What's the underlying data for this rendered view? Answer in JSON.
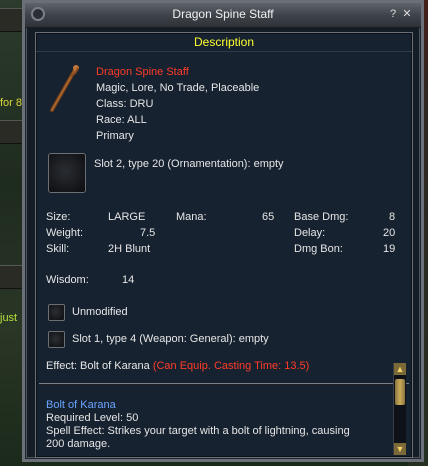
{
  "background": {
    "left_text_1": "for 8",
    "left_text_2": "just"
  },
  "window": {
    "title": "Dragon Spine Staff",
    "help_label": "?",
    "close_label": "✕"
  },
  "description": {
    "header": "Description",
    "item_name": "Dragon Spine Staff",
    "flags": "Magic, Lore, No Trade, Placeable",
    "class": "Class: DRU",
    "race": "Race: ALL",
    "slot_type": "Primary",
    "ornament_slot": "Slot 2, type 20 (Ornamentation): empty"
  },
  "stats": {
    "size_label": "Size:",
    "size_value": "LARGE",
    "weight_label": "Weight:",
    "weight_value": "7.5",
    "skill_label": "Skill:",
    "skill_value": "2H Blunt",
    "mana_label": "Mana:",
    "mana_value": "65",
    "base_dmg_label": "Base Dmg:",
    "base_dmg_value": "8",
    "delay_label": "Delay:",
    "delay_value": "20",
    "dmg_bon_label": "Dmg Bon:",
    "dmg_bon_value": "19",
    "wisdom_label": "Wisdom:",
    "wisdom_value": "14"
  },
  "augments": {
    "unmodified_label": "Unmodified",
    "weapon_slot": "Slot 1, type 4 (Weapon: General): empty"
  },
  "effect": {
    "label": "Effect: Bolt of Karana",
    "detail": "(Can Equip. Casting Time: 13.5)"
  },
  "spell": {
    "name": "Bolt of Karana",
    "required_level": "Required Level: 50",
    "effect_line1": "Spell Effect: Strikes your target with a bolt of lightning, causing",
    "effect_line2": "200 damage."
  },
  "colors": {
    "header_yellow": "#ffff30",
    "item_name_red": "#ff3b28",
    "spell_blue": "#6aa4ff",
    "panel_bg": "#172230"
  }
}
